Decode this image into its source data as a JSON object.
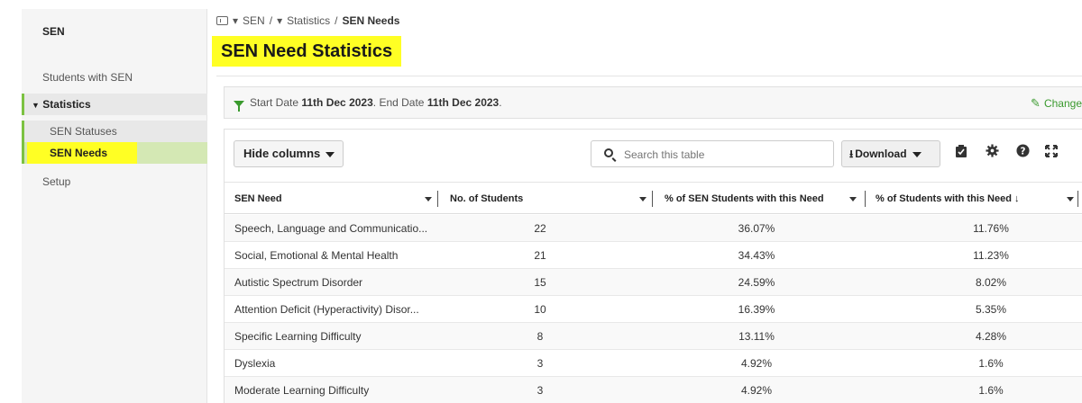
{
  "sidebar": {
    "title": "SEN",
    "items": [
      {
        "label": "Students with SEN"
      },
      {
        "label": "Statistics",
        "expanded_glyph": "▼"
      },
      {
        "label": "SEN Statuses"
      },
      {
        "label": "SEN Needs"
      },
      {
        "label": "Setup"
      }
    ]
  },
  "breadcrumb": {
    "caret": "▾",
    "items": [
      "SEN",
      "Statistics",
      "SEN Needs"
    ],
    "separator": "/"
  },
  "page": {
    "title": "SEN Need Statistics"
  },
  "filter": {
    "start_label": "Start Date",
    "start_value": "11th Dec 2023",
    "end_label": "End Date",
    "end_value": "11th Dec 2023",
    "change_label": "Change"
  },
  "toolbar": {
    "hide_columns_label": "Hide columns",
    "search_placeholder": "Search this table",
    "download_label": "Download",
    "download_icon": "⭳",
    "clipboard_icon": "✔",
    "settings_icon": "✱",
    "help_icon": "?",
    "expand_icon": "✕"
  },
  "table": {
    "columns": [
      "SEN Need",
      "No. of Students",
      "% of SEN Students with this Need",
      "% of Students with this Need ↓"
    ],
    "rows": [
      [
        "Speech, Language and Communicatio...",
        "22",
        "36.07%",
        "11.76%"
      ],
      [
        "Social, Emotional & Mental Health",
        "21",
        "34.43%",
        "11.23%"
      ],
      [
        "Autistic Spectrum Disorder",
        "15",
        "24.59%",
        "8.02%"
      ],
      [
        "Attention Deficit (Hyperactivity) Disor...",
        "10",
        "16.39%",
        "5.35%"
      ],
      [
        "Specific Learning Difficulty",
        "8",
        "13.11%",
        "4.28%"
      ],
      [
        "Dyslexia",
        "3",
        "4.92%",
        "1.6%"
      ],
      [
        "Moderate Learning Difficulty",
        "3",
        "4.92%",
        "1.6%"
      ]
    ]
  },
  "colors": {
    "accent_green": "#7cc242",
    "highlight_yellow": "#ffff24",
    "link_green": "#3a9a2e"
  }
}
